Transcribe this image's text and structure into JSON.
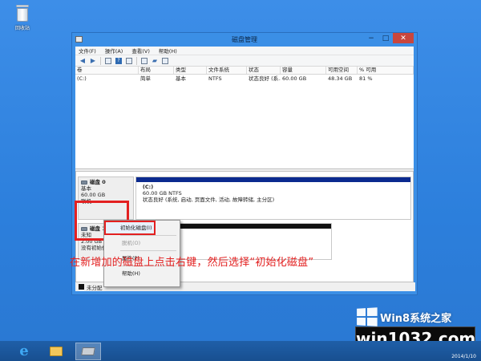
{
  "desktop": {
    "recycle_label": "回收站"
  },
  "window": {
    "title": "磁盘管理",
    "controls": {
      "minimize": "−",
      "maximize": "□",
      "close": "✕"
    },
    "menu": [
      "文件(F)",
      "操作(A)",
      "查看(V)",
      "帮助(H)"
    ],
    "toolbar_icons": [
      "back-icon",
      "forward-icon",
      "grid-icon",
      "help-icon",
      "list-icon",
      "properties-icon",
      "folder-icon",
      "options-icon"
    ]
  },
  "volume_table": {
    "headers": [
      "卷",
      "布局",
      "类型",
      "文件系统",
      "状态",
      "容量",
      "可用空间",
      "% 可用"
    ],
    "rows": [
      [
        "(C:)",
        "简单",
        "基本",
        "NTFS",
        "状态良好 (系...",
        "60.00 GB",
        "48.34 GB",
        "81 %"
      ]
    ]
  },
  "disks": [
    {
      "name": "磁盘 0",
      "type": "基本",
      "size": "60.00 GB",
      "status": "联机",
      "partition": {
        "label": "(C:)",
        "size_fs": "60.00 GB NTFS",
        "status": "状态良好 (系统, 启动, 页面文件, 活动, 故障转储, 主分区)"
      }
    },
    {
      "name": "磁盘 1",
      "type": "未知",
      "size": "2.00 GB",
      "status": "没有初始化"
    }
  ],
  "legend": {
    "unallocated": "未分配"
  },
  "context_menu": {
    "items": [
      {
        "label": "初始化磁盘(I)",
        "state": "active"
      },
      {
        "label": "脱机(O)",
        "state": "disabled"
      },
      {
        "label": "属性(P)",
        "state": "normal"
      },
      {
        "label": "帮助(H)",
        "state": "normal"
      }
    ]
  },
  "annotation": "在新增加的磁盘上点击右键，然后选择“初始化磁盘”",
  "watermark": {
    "brand": "Win8系统之家",
    "site": "win1032.com"
  },
  "clock": {
    "date": "2014/1/10"
  },
  "colors": {
    "partition_bar": "#0b2a8f",
    "unallocated_bar": "#111111",
    "highlight": "#e32020"
  }
}
